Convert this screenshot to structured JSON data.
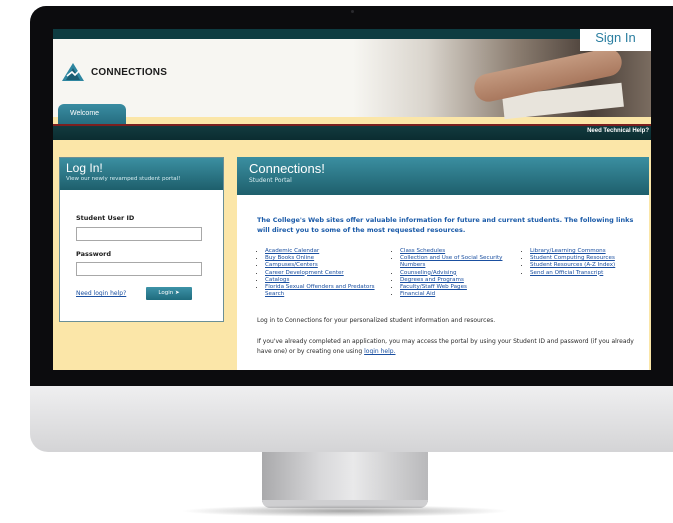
{
  "header": {
    "sign_in": "Sign In",
    "brand": "CONNECTIONS",
    "tab_welcome": "Welcome",
    "tech_help": "Need Technical Help?"
  },
  "login": {
    "title": "Log In!",
    "subtitle": "View our newly revamped student portal!",
    "user_label": "Student User ID",
    "user_value": "",
    "password_label": "Password",
    "password_value": "",
    "help_link": "Need login help?",
    "button": "Login"
  },
  "main": {
    "title": "Connections!",
    "subtitle": "Student Portal",
    "intro": "The College's Web sites offer valuable information for future and current students. The following links will direct you to some of the most requested resources.",
    "links_col1": [
      "Academic Calendar",
      "Buy Books Online",
      "Campuses/Centers",
      "Career Development Center",
      "Catalogs",
      "Florida Sexual Offenders and Predators Search"
    ],
    "links_col2": [
      "Class Schedules",
      "Collection and Use of Social Security Numbers",
      "Counseling/Advising",
      "Degrees and Programs",
      "Faculty/Staff Web Pages",
      "Financial Aid"
    ],
    "links_col3": [
      "Library/Learning Commons",
      "Student Computing Resources",
      "Student Resources (A-Z Index)",
      "Send an Official Transcript"
    ],
    "para1": "Log in to Connections for your personalized student information and resources.",
    "para2_text": "If you've already completed an application, you may access the portal by using your Student ID and password (if you already have one) or by creating one using",
    "para2_link": "login help."
  },
  "colors": {
    "teal": "#2a7a8c",
    "page_bg": "#fbe6a8",
    "link": "#1a4fa0",
    "intro_blue": "#1a5aa8"
  }
}
